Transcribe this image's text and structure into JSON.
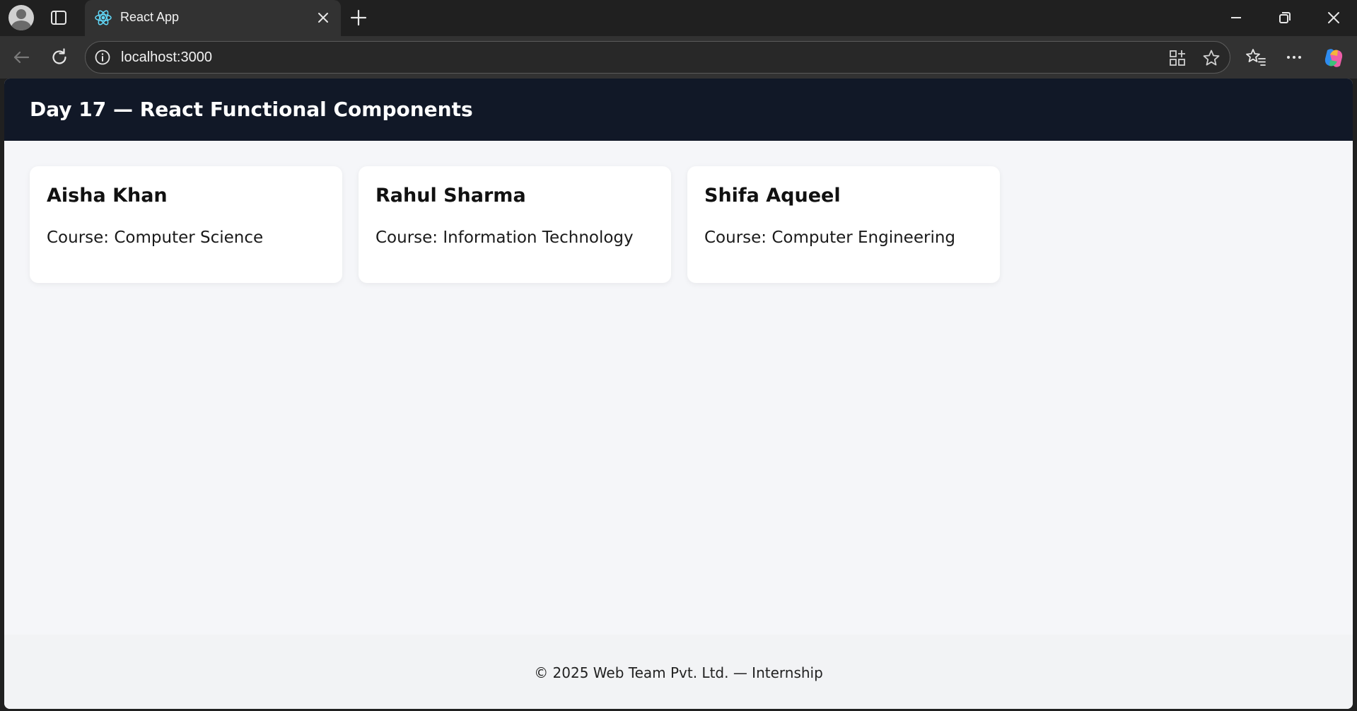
{
  "browser": {
    "tab": {
      "title": "React App",
      "favicon": "react-icon"
    },
    "address_bar": {
      "url": "localhost:3000"
    },
    "accent_color": "#61dafb"
  },
  "app": {
    "header": {
      "title": "Day 17 — React Functional Components"
    },
    "students": [
      {
        "name": "Aisha Khan",
        "course": "Course: Computer Science"
      },
      {
        "name": "Rahul Sharma",
        "course": "Course: Information Technology"
      },
      {
        "name": "Shifa Aqueel",
        "course": "Course: Computer Engineering"
      }
    ],
    "footer": {
      "text": "© 2025 Web Team Pvt. Ltd. — Internship"
    },
    "colors": {
      "header_bg": "#111827",
      "page_bg": "#f5f6f9",
      "card_bg": "#ffffff"
    }
  }
}
